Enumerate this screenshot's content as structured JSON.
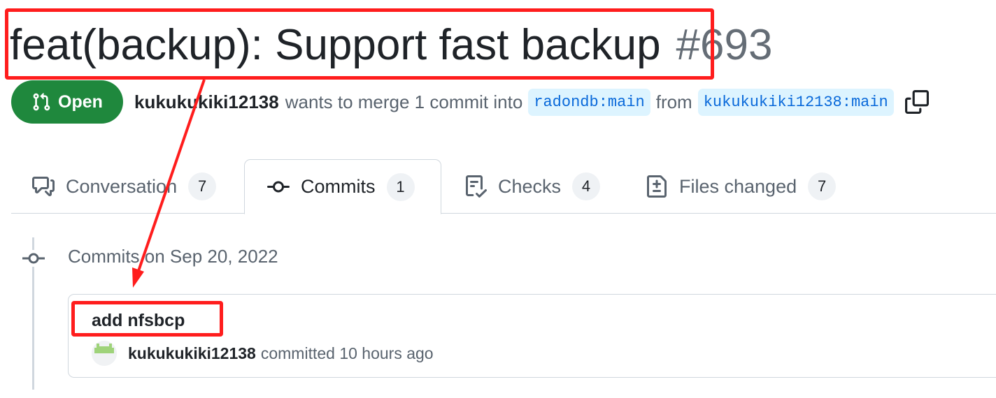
{
  "pr": {
    "title": "feat(backup):  Support fast backup",
    "number": "#693",
    "state_label": "Open",
    "author": "kukukukiki12138",
    "merge_text": "wants to merge 1 commit into",
    "base_branch": "radondb:main",
    "from_text": "from",
    "head_branch": "kukukukiki12138:main"
  },
  "tabs": [
    {
      "label": "Conversation",
      "count": "7",
      "icon": "comment-discussion-icon"
    },
    {
      "label": "Commits",
      "count": "1",
      "icon": "git-commit-icon",
      "active": true
    },
    {
      "label": "Checks",
      "count": "4",
      "icon": "checklist-icon"
    },
    {
      "label": "Files changed",
      "count": "7",
      "icon": "file-diff-icon"
    }
  ],
  "timeline": {
    "date_label": "Commits on Sep 20, 2022",
    "commit": {
      "title": "add nfsbcp",
      "author": "kukukukiki12138",
      "meta": "committed 10 hours ago"
    }
  },
  "colors": {
    "open_green": "#1f883d",
    "link_blue": "#0969da",
    "branch_bg": "#ddf4ff",
    "annotation_red": "#ff1d1d"
  }
}
